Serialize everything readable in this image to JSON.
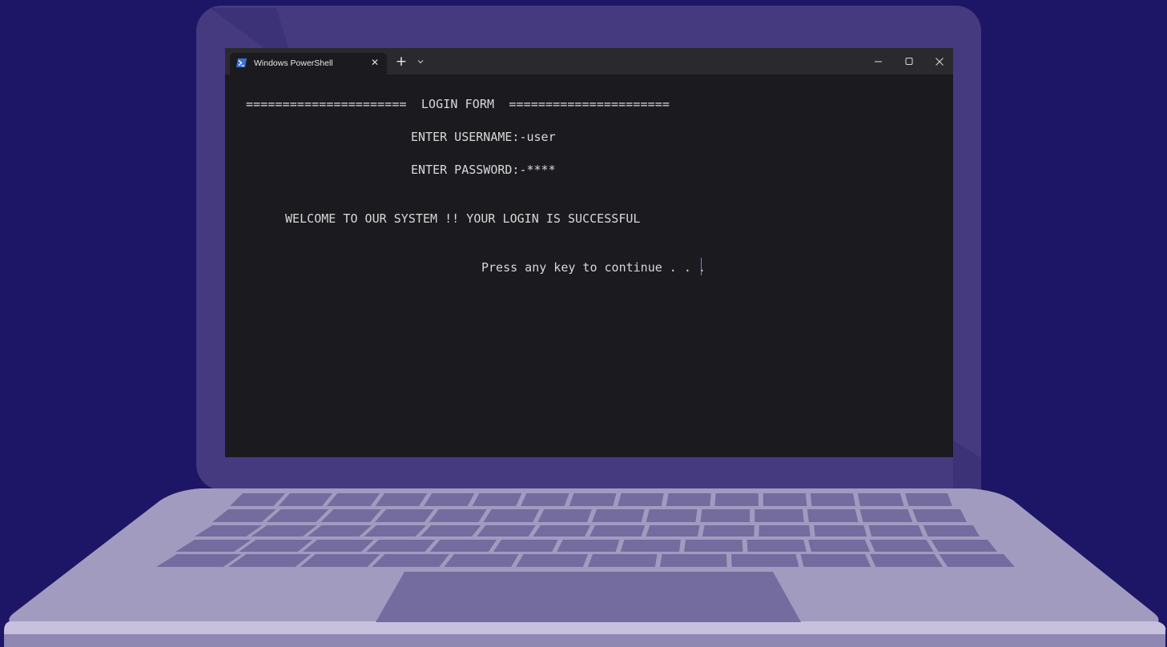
{
  "window": {
    "tab_title": "Windows PowerShell",
    "tab_icon": "powershell-icon",
    "new_tab_label": "+",
    "controls": [
      "minimize-icon",
      "maximize-icon",
      "close-icon"
    ]
  },
  "console": {
    "lines": [
      "======================  LOGIN FORM  ======================",
      "ENTER USERNAME:-user",
      "ENTER PASSWORD:-****",
      "WELCOME TO OUR SYSTEM !! YOUR LOGIN IS SUCCESSFUL",
      "Press any key to continue . . ."
    ]
  },
  "colors": {
    "background": "#1d1565",
    "laptop_lid": "#453a80",
    "laptop_base": "#a29bc0",
    "keys": "#746c9f",
    "terminal_bg": "#1b1b1f",
    "titlebar_bg": "#2a2a2e",
    "text": "#d8d8d8"
  }
}
